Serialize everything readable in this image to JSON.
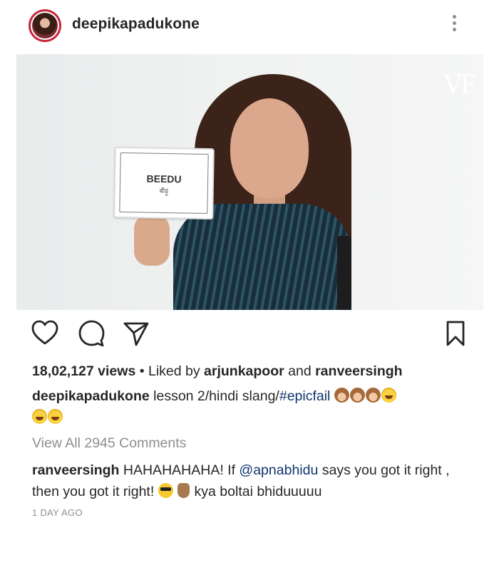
{
  "post": {
    "username": "deepikapadukone"
  },
  "media": {
    "watermark": "VF",
    "sign_word": "BEEDU",
    "sign_subtext": "बीड़ू"
  },
  "actions": {
    "like_icon": "heart-icon",
    "comment_icon": "comment-bubble-icon",
    "share_icon": "paper-plane-icon",
    "save_icon": "bookmark-icon"
  },
  "stats": {
    "views": "18,02,127 views",
    "separator": " • ",
    "liked_by_prefix": "Liked by ",
    "liked_by_user1": "arjunkapoor",
    "liked_by_and": " and ",
    "liked_by_user2": "ranveersingh"
  },
  "caption": {
    "username": "deepikapadukone",
    "text": " lesson 2/hindi slang/",
    "hashtag": "#epicfail",
    "emojis": [
      "see-no-evil-monkey",
      "see-no-evil-monkey",
      "see-no-evil-monkey",
      "grinning-sweat",
      "grinning-sweat",
      "grinning-sweat"
    ]
  },
  "comments": {
    "view_all": "View All 2945 Comments",
    "items": [
      {
        "username": "ranveersingh",
        "text_before": " HAHAHAHAHA! If ",
        "mention": "@apnabhidu",
        "text_after": " says you got it right , then you got it right! ",
        "emojis": [
          "sunglasses-face",
          "rock-on-hand"
        ],
        "text_end": " kya boltai bhiduuuuu"
      }
    ]
  },
  "timestamp": "1 DAY AGO"
}
